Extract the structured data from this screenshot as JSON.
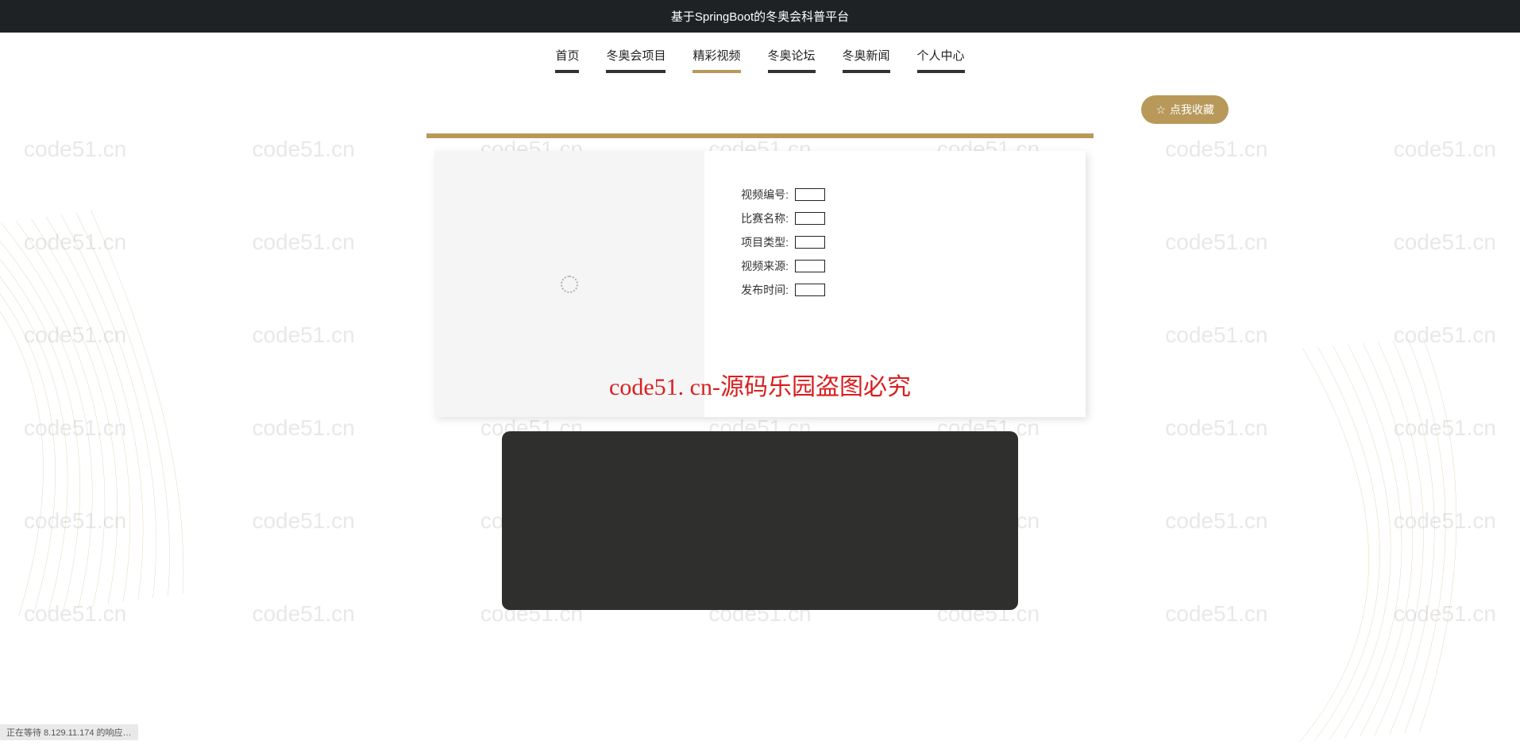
{
  "header": {
    "title": "基于SpringBoot的冬奥会科普平台"
  },
  "nav": {
    "items": [
      {
        "label": "首页",
        "active": false
      },
      {
        "label": "冬奥会项目",
        "active": false
      },
      {
        "label": "精彩视频",
        "active": true
      },
      {
        "label": "冬奥论坛",
        "active": false
      },
      {
        "label": "冬奥新闻",
        "active": false
      },
      {
        "label": "个人中心",
        "active": false
      }
    ]
  },
  "actions": {
    "favorite_label": "点我收藏"
  },
  "details": {
    "fields": [
      {
        "label": "视频编号:",
        "value": ""
      },
      {
        "label": "比赛名称:",
        "value": ""
      },
      {
        "label": "项目类型:",
        "value": ""
      },
      {
        "label": "视频来源:",
        "value": ""
      },
      {
        "label": "发布时间:",
        "value": ""
      }
    ]
  },
  "watermark": {
    "text": "code51.cn",
    "banner": "code51. cn-源码乐园盗图必究"
  },
  "status": {
    "text": "正在等待 8.129.11.174 的响应…"
  }
}
